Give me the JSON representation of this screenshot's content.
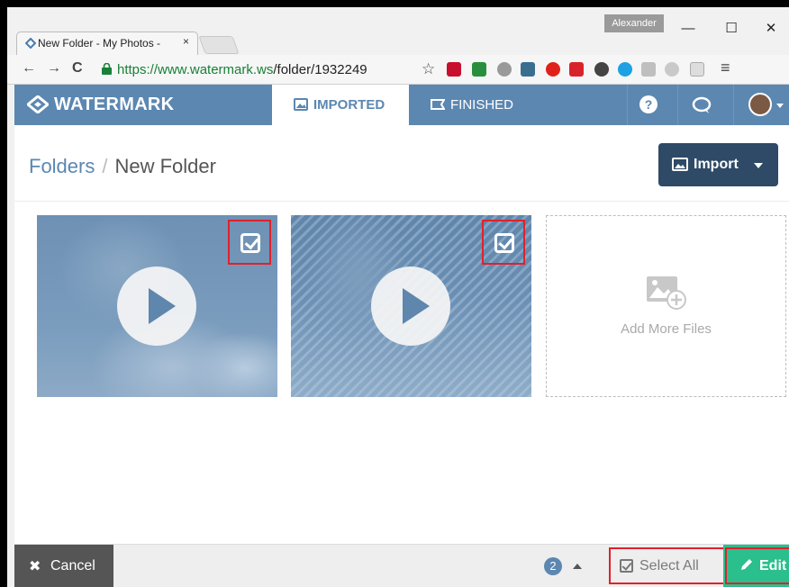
{
  "browser": {
    "tab_title": "New Folder - My Photos -",
    "tab_close": "×",
    "user": "Alexander",
    "minimize": "—",
    "maximize": "☐",
    "close": "✕",
    "back": "←",
    "forward": "→",
    "reload": "C",
    "url_host": "https://www.watermark.ws",
    "url_path": "/folder/1932249",
    "star": "☆",
    "menu": "≡"
  },
  "app": {
    "brand": "WATERMARK",
    "tabs": [
      {
        "label": "IMPORTED",
        "active": true
      },
      {
        "label": "FINISHED",
        "active": false
      }
    ],
    "help": "?",
    "colors": {
      "header": "#5b87b1",
      "dark_button": "#2e4a66",
      "edit": "#2bbf8d",
      "highlight": "#e0212b"
    }
  },
  "breadcrumb": {
    "root": "Folders",
    "separator": "/",
    "current": "New Folder"
  },
  "import_button": "Import",
  "files": [
    {
      "type": "video",
      "selected": true
    },
    {
      "type": "video",
      "selected": true
    }
  ],
  "add_more": "Add More Files",
  "footer": {
    "cancel": "Cancel",
    "selected_count": "2",
    "select_all": "Select All",
    "edit": "Edit"
  }
}
